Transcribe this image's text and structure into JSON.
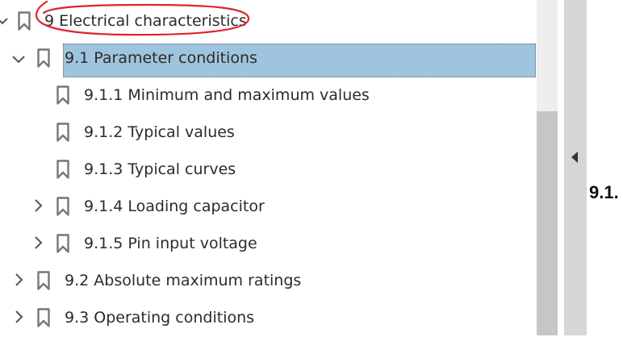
{
  "bookmarks": {
    "items": [
      {
        "label": "9 Electrical characteristics"
      },
      {
        "label": "9.1 Parameter conditions"
      },
      {
        "label": "9.1.1 Minimum and maximum values"
      },
      {
        "label": "9.1.2 Typical values"
      },
      {
        "label": "9.1.3 Typical curves"
      },
      {
        "label": "9.1.4 Loading capacitor"
      },
      {
        "label": "9.1.5 Pin input voltage"
      },
      {
        "label": "9.2 Absolute maximum ratings"
      },
      {
        "label": "9.3 Operating conditions"
      }
    ]
  },
  "document": {
    "visible_heading": "9.1."
  },
  "colors": {
    "selection": "#9fc4dd",
    "annotation": "#e0242a"
  },
  "icons": {
    "bookmark": "bookmark-icon",
    "expand": "chevron-right-icon",
    "collapse": "chevron-down-icon"
  }
}
